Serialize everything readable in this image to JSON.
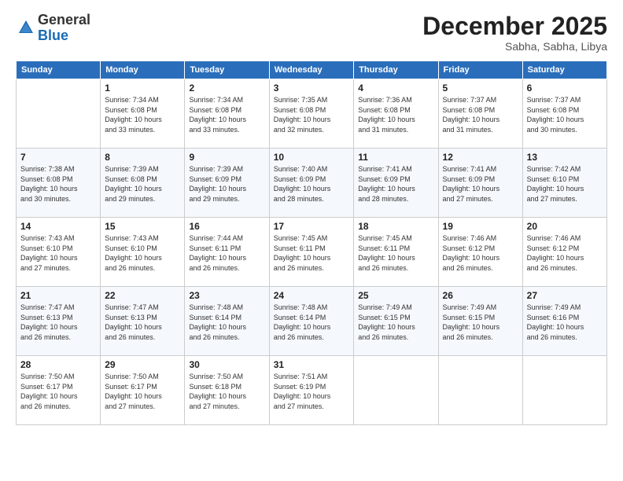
{
  "header": {
    "logo_general": "General",
    "logo_blue": "Blue",
    "month_title": "December 2025",
    "location": "Sabha, Sabha, Libya"
  },
  "columns": [
    "Sunday",
    "Monday",
    "Tuesday",
    "Wednesday",
    "Thursday",
    "Friday",
    "Saturday"
  ],
  "weeks": [
    [
      {
        "day": "",
        "info": ""
      },
      {
        "day": "1",
        "info": "Sunrise: 7:34 AM\nSunset: 6:08 PM\nDaylight: 10 hours\nand 33 minutes."
      },
      {
        "day": "2",
        "info": "Sunrise: 7:34 AM\nSunset: 6:08 PM\nDaylight: 10 hours\nand 33 minutes."
      },
      {
        "day": "3",
        "info": "Sunrise: 7:35 AM\nSunset: 6:08 PM\nDaylight: 10 hours\nand 32 minutes."
      },
      {
        "day": "4",
        "info": "Sunrise: 7:36 AM\nSunset: 6:08 PM\nDaylight: 10 hours\nand 31 minutes."
      },
      {
        "day": "5",
        "info": "Sunrise: 7:37 AM\nSunset: 6:08 PM\nDaylight: 10 hours\nand 31 minutes."
      },
      {
        "day": "6",
        "info": "Sunrise: 7:37 AM\nSunset: 6:08 PM\nDaylight: 10 hours\nand 30 minutes."
      }
    ],
    [
      {
        "day": "7",
        "info": "Sunrise: 7:38 AM\nSunset: 6:08 PM\nDaylight: 10 hours\nand 30 minutes."
      },
      {
        "day": "8",
        "info": "Sunrise: 7:39 AM\nSunset: 6:08 PM\nDaylight: 10 hours\nand 29 minutes."
      },
      {
        "day": "9",
        "info": "Sunrise: 7:39 AM\nSunset: 6:09 PM\nDaylight: 10 hours\nand 29 minutes."
      },
      {
        "day": "10",
        "info": "Sunrise: 7:40 AM\nSunset: 6:09 PM\nDaylight: 10 hours\nand 28 minutes."
      },
      {
        "day": "11",
        "info": "Sunrise: 7:41 AM\nSunset: 6:09 PM\nDaylight: 10 hours\nand 28 minutes."
      },
      {
        "day": "12",
        "info": "Sunrise: 7:41 AM\nSunset: 6:09 PM\nDaylight: 10 hours\nand 27 minutes."
      },
      {
        "day": "13",
        "info": "Sunrise: 7:42 AM\nSunset: 6:10 PM\nDaylight: 10 hours\nand 27 minutes."
      }
    ],
    [
      {
        "day": "14",
        "info": "Sunrise: 7:43 AM\nSunset: 6:10 PM\nDaylight: 10 hours\nand 27 minutes."
      },
      {
        "day": "15",
        "info": "Sunrise: 7:43 AM\nSunset: 6:10 PM\nDaylight: 10 hours\nand 26 minutes."
      },
      {
        "day": "16",
        "info": "Sunrise: 7:44 AM\nSunset: 6:11 PM\nDaylight: 10 hours\nand 26 minutes."
      },
      {
        "day": "17",
        "info": "Sunrise: 7:45 AM\nSunset: 6:11 PM\nDaylight: 10 hours\nand 26 minutes."
      },
      {
        "day": "18",
        "info": "Sunrise: 7:45 AM\nSunset: 6:11 PM\nDaylight: 10 hours\nand 26 minutes."
      },
      {
        "day": "19",
        "info": "Sunrise: 7:46 AM\nSunset: 6:12 PM\nDaylight: 10 hours\nand 26 minutes."
      },
      {
        "day": "20",
        "info": "Sunrise: 7:46 AM\nSunset: 6:12 PM\nDaylight: 10 hours\nand 26 minutes."
      }
    ],
    [
      {
        "day": "21",
        "info": "Sunrise: 7:47 AM\nSunset: 6:13 PM\nDaylight: 10 hours\nand 26 minutes."
      },
      {
        "day": "22",
        "info": "Sunrise: 7:47 AM\nSunset: 6:13 PM\nDaylight: 10 hours\nand 26 minutes."
      },
      {
        "day": "23",
        "info": "Sunrise: 7:48 AM\nSunset: 6:14 PM\nDaylight: 10 hours\nand 26 minutes."
      },
      {
        "day": "24",
        "info": "Sunrise: 7:48 AM\nSunset: 6:14 PM\nDaylight: 10 hours\nand 26 minutes."
      },
      {
        "day": "25",
        "info": "Sunrise: 7:49 AM\nSunset: 6:15 PM\nDaylight: 10 hours\nand 26 minutes."
      },
      {
        "day": "26",
        "info": "Sunrise: 7:49 AM\nSunset: 6:15 PM\nDaylight: 10 hours\nand 26 minutes."
      },
      {
        "day": "27",
        "info": "Sunrise: 7:49 AM\nSunset: 6:16 PM\nDaylight: 10 hours\nand 26 minutes."
      }
    ],
    [
      {
        "day": "28",
        "info": "Sunrise: 7:50 AM\nSunset: 6:17 PM\nDaylight: 10 hours\nand 26 minutes."
      },
      {
        "day": "29",
        "info": "Sunrise: 7:50 AM\nSunset: 6:17 PM\nDaylight: 10 hours\nand 27 minutes."
      },
      {
        "day": "30",
        "info": "Sunrise: 7:50 AM\nSunset: 6:18 PM\nDaylight: 10 hours\nand 27 minutes."
      },
      {
        "day": "31",
        "info": "Sunrise: 7:51 AM\nSunset: 6:19 PM\nDaylight: 10 hours\nand 27 minutes."
      },
      {
        "day": "",
        "info": ""
      },
      {
        "day": "",
        "info": ""
      },
      {
        "day": "",
        "info": ""
      }
    ]
  ]
}
